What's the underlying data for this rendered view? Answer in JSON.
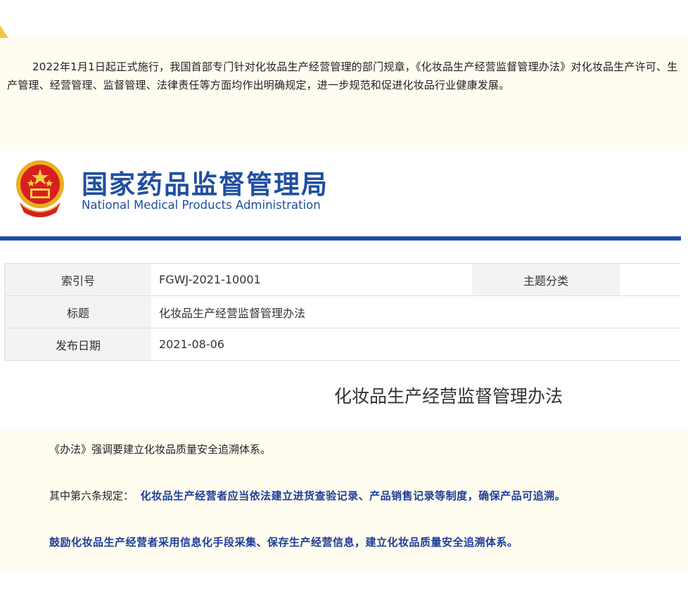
{
  "intro": {
    "text": "2022年1月1日起正式施行，我国首部专门针对化妆品生产经营管理的部门规章，《化妆品生产经营监督管理办法》对化妆品生产许可、生产管理、经营管理、监督管理、法律责任等方面均作出明确规定，进一步规范和促进化妆品行业健康发展。"
  },
  "agency": {
    "name_cn": "国家药品监督管理局",
    "name_en": "National Medical Products Administration"
  },
  "meta": {
    "index_label": "索引号",
    "index_value": "FGWJ-2021-10001",
    "topic_label": "主题分类",
    "title_label": "标题",
    "title_value": "化妆品生产经营监督管理办法",
    "date_label": "发布日期",
    "date_value": "2021-08-06"
  },
  "doc_title": "化妆品生产经营监督管理办法",
  "notes": {
    "line1": "《办法》强调要建立化妆品质量安全追溯体系。",
    "line2_prefix": "其中第六条规定：",
    "line2_bold": "化妆品生产经营者应当依法建立进货查验记录、产品销售记录等制度，确保产品可追溯。",
    "line3_bold": "鼓励化妆品生产经营者采用信息化手段采集、保存生产经营信息，建立化妆品质量安全追溯体系。"
  },
  "colors": {
    "brand_blue": "#1f4fa0",
    "rule_blue": "#1b4fa3",
    "note_blue": "#1f3d99",
    "cream_bg": "#fffcf0"
  }
}
